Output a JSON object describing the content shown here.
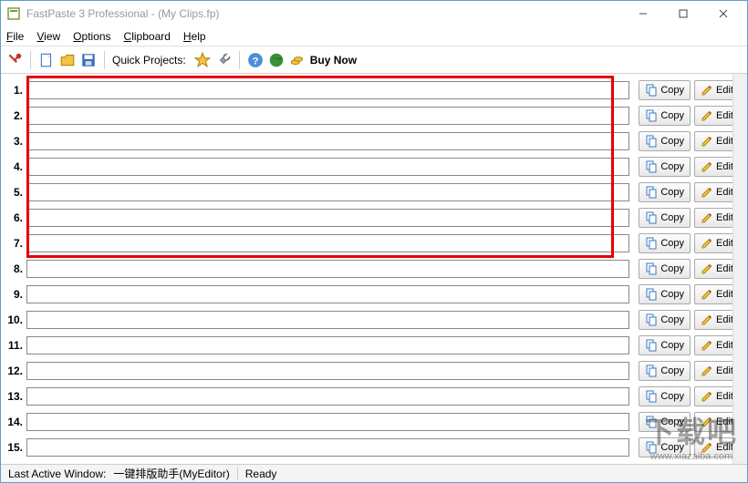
{
  "window": {
    "title": "FastPaste 3 Professional -  (My Clips.fp)"
  },
  "menu": {
    "file": "File",
    "view": "View",
    "options": "Options",
    "clipboard": "Clipboard",
    "help": "Help"
  },
  "toolbar": {
    "quick_projects": "Quick Projects:",
    "buy_now": "Buy Now"
  },
  "clips": [
    {
      "n": "1.",
      "v": "<empty>"
    },
    {
      "n": "2.",
      "v": "<empty>"
    },
    {
      "n": "3.",
      "v": "<empty>"
    },
    {
      "n": "4.",
      "v": "<empty>"
    },
    {
      "n": "5.",
      "v": "<empty>"
    },
    {
      "n": "6.",
      "v": "<empty>"
    },
    {
      "n": "7.",
      "v": "<empty>"
    },
    {
      "n": "8.",
      "v": "<empty>"
    },
    {
      "n": "9.",
      "v": "<empty>"
    },
    {
      "n": "10.",
      "v": "<empty>"
    },
    {
      "n": "11.",
      "v": "<empty>"
    },
    {
      "n": "12.",
      "v": "<empty>"
    },
    {
      "n": "13.",
      "v": "<empty>"
    },
    {
      "n": "14.",
      "v": "<empty>"
    },
    {
      "n": "15.",
      "v": "<empty>"
    }
  ],
  "buttons": {
    "copy": "Copy",
    "edit": "Edit"
  },
  "status": {
    "last_active_label": "Last Active Window:",
    "last_active_value": "一键排版助手(MyEditor)",
    "ready": "Ready"
  },
  "watermark": {
    "big": "下载吧",
    "small": "www.xiazaiba.com"
  }
}
